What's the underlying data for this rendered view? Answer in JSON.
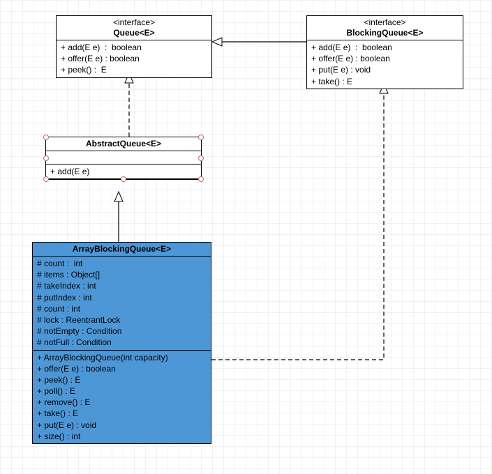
{
  "queue": {
    "stereo": "<interface>",
    "name": "Queue<E>",
    "ops": [
      "+ add(E e)  :  boolean",
      "+ offer(E e) : boolean",
      "+ peek() :  E"
    ]
  },
  "blockingQueue": {
    "stereo": "<interface>",
    "name": "BlockingQueue<E>",
    "ops": [
      "+ add(E e)  :  boolean",
      "+ offer(E e) : boolean",
      "+ put(E e) : void",
      "+ take() : E"
    ]
  },
  "abstractQueue": {
    "name": "AbstractQueue<E>",
    "ops": [
      "+ add(E e)"
    ]
  },
  "arrayBlockingQueue": {
    "name": "ArrayBlockingQueue<E>",
    "attrs": [
      "# count :  int",
      "# items : Object[]",
      "# takeIndex : int",
      "# putIndex : int",
      "# count : int",
      "# lock : ReentrantLock",
      "# notEmpty : Condition",
      "# notFull : Condition"
    ],
    "ops": [
      "+ ArrayBlockingQueue(int capacity)",
      "+ offer(E e) : boolean",
      "+ peek() : E",
      "+ poll() : E",
      "+ remove() : E",
      "+ take() : E",
      "+ put(E e) : void",
      "+ size() : int"
    ]
  },
  "chart_data": {
    "type": "table",
    "description": "UML class diagram showing Queue / BlockingQueue interfaces, AbstractQueue abstract class, and ArrayBlockingQueue implementation.",
    "nodes": [
      {
        "id": "Queue",
        "kind": "interface",
        "name": "Queue<E>",
        "methods": [
          "+ add(E e):boolean",
          "+ offer(E e):boolean",
          "+ peek():E"
        ]
      },
      {
        "id": "BlockingQueue",
        "kind": "interface",
        "name": "BlockingQueue<E>",
        "methods": [
          "+ add(E e):boolean",
          "+ offer(E e):boolean",
          "+ put(E e):void",
          "+ take():E"
        ]
      },
      {
        "id": "AbstractQueue",
        "kind": "abstract-class",
        "name": "AbstractQueue<E>",
        "methods": [
          "+ add(E e)"
        ]
      },
      {
        "id": "ArrayBlockingQueue",
        "kind": "class",
        "name": "ArrayBlockingQueue<E>",
        "attributes": [
          "# count:int",
          "# items:Object[]",
          "# takeIndex:int",
          "# putIndex:int",
          "# count:int",
          "# lock:ReentrantLock",
          "# notEmpty:Condition",
          "# notFull:Condition"
        ],
        "methods": [
          "+ ArrayBlockingQueue(int capacity)",
          "+ offer(E e):boolean",
          "+ peek():E",
          "+ poll():E",
          "+ remove():E",
          "+ take():E",
          "+ put(E e):void",
          "+ size():int"
        ]
      }
    ],
    "edges": [
      {
        "from": "BlockingQueue",
        "to": "Queue",
        "relation": "extends-interface",
        "style": "solid-generalization"
      },
      {
        "from": "AbstractQueue",
        "to": "Queue",
        "relation": "implements",
        "style": "dashed-realization"
      },
      {
        "from": "ArrayBlockingQueue",
        "to": "AbstractQueue",
        "relation": "extends",
        "style": "solid-generalization"
      },
      {
        "from": "ArrayBlockingQueue",
        "to": "BlockingQueue",
        "relation": "implements",
        "style": "dashed-realization"
      }
    ]
  }
}
